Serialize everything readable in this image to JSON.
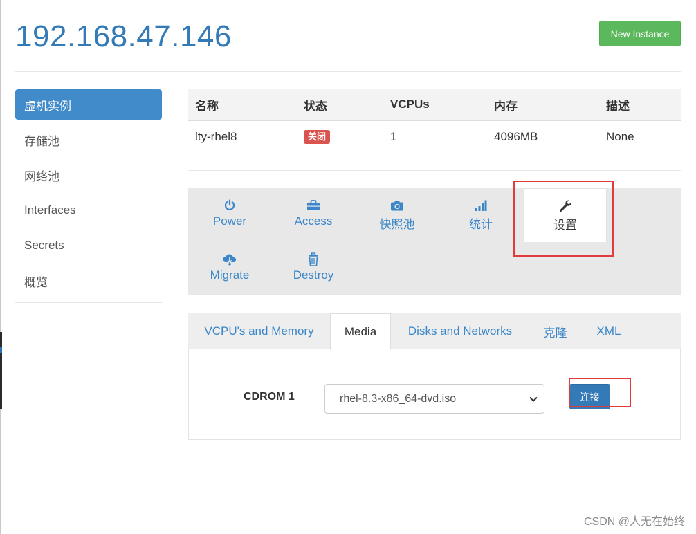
{
  "header": {
    "host_title": "192.168.47.146",
    "new_instance_label": "New Instance"
  },
  "sidebar": {
    "items": [
      {
        "label": "虚机实例",
        "active": true
      },
      {
        "label": "存储池"
      },
      {
        "label": "网络池"
      },
      {
        "label": "Interfaces"
      },
      {
        "label": "Secrets"
      },
      {
        "label": "概览"
      }
    ]
  },
  "instance_table": {
    "columns": [
      "名称",
      "状态",
      "VCPUs",
      "内存",
      "描述"
    ],
    "rows": [
      {
        "name": "lty-rhel8",
        "status": "关闭",
        "vcpus": "1",
        "memory": "4096MB",
        "description": "None"
      }
    ]
  },
  "actions": {
    "items": [
      {
        "label": "Power",
        "icon": "power-icon"
      },
      {
        "label": "Access",
        "icon": "briefcase-icon"
      },
      {
        "label": "快照池",
        "icon": "camera-icon"
      },
      {
        "label": "统计",
        "icon": "signal-bars-icon"
      },
      {
        "label": "设置",
        "icon": "wrench-icon",
        "selected": true
      },
      {
        "label": "Migrate",
        "icon": "cloud-download-icon"
      },
      {
        "label": "Destroy",
        "icon": "trash-icon"
      }
    ]
  },
  "settings_tabs": {
    "items": [
      {
        "label": "VCPU's and Memory"
      },
      {
        "label": "Media",
        "active": true
      },
      {
        "label": "Disks and Networks"
      },
      {
        "label": "克隆"
      },
      {
        "label": "XML"
      }
    ]
  },
  "media": {
    "cdrom_label": "CDROM 1",
    "selected_iso": "rhel-8.3-x86_64-dvd.iso",
    "connect_label": "连接"
  },
  "colors": {
    "primary": "#337ab7",
    "sidebar_active": "#428bca",
    "success": "#5cb85c",
    "danger": "#d9534f",
    "highlight_box": "#e23b3b"
  },
  "watermark": "CSDN @人无在始终"
}
